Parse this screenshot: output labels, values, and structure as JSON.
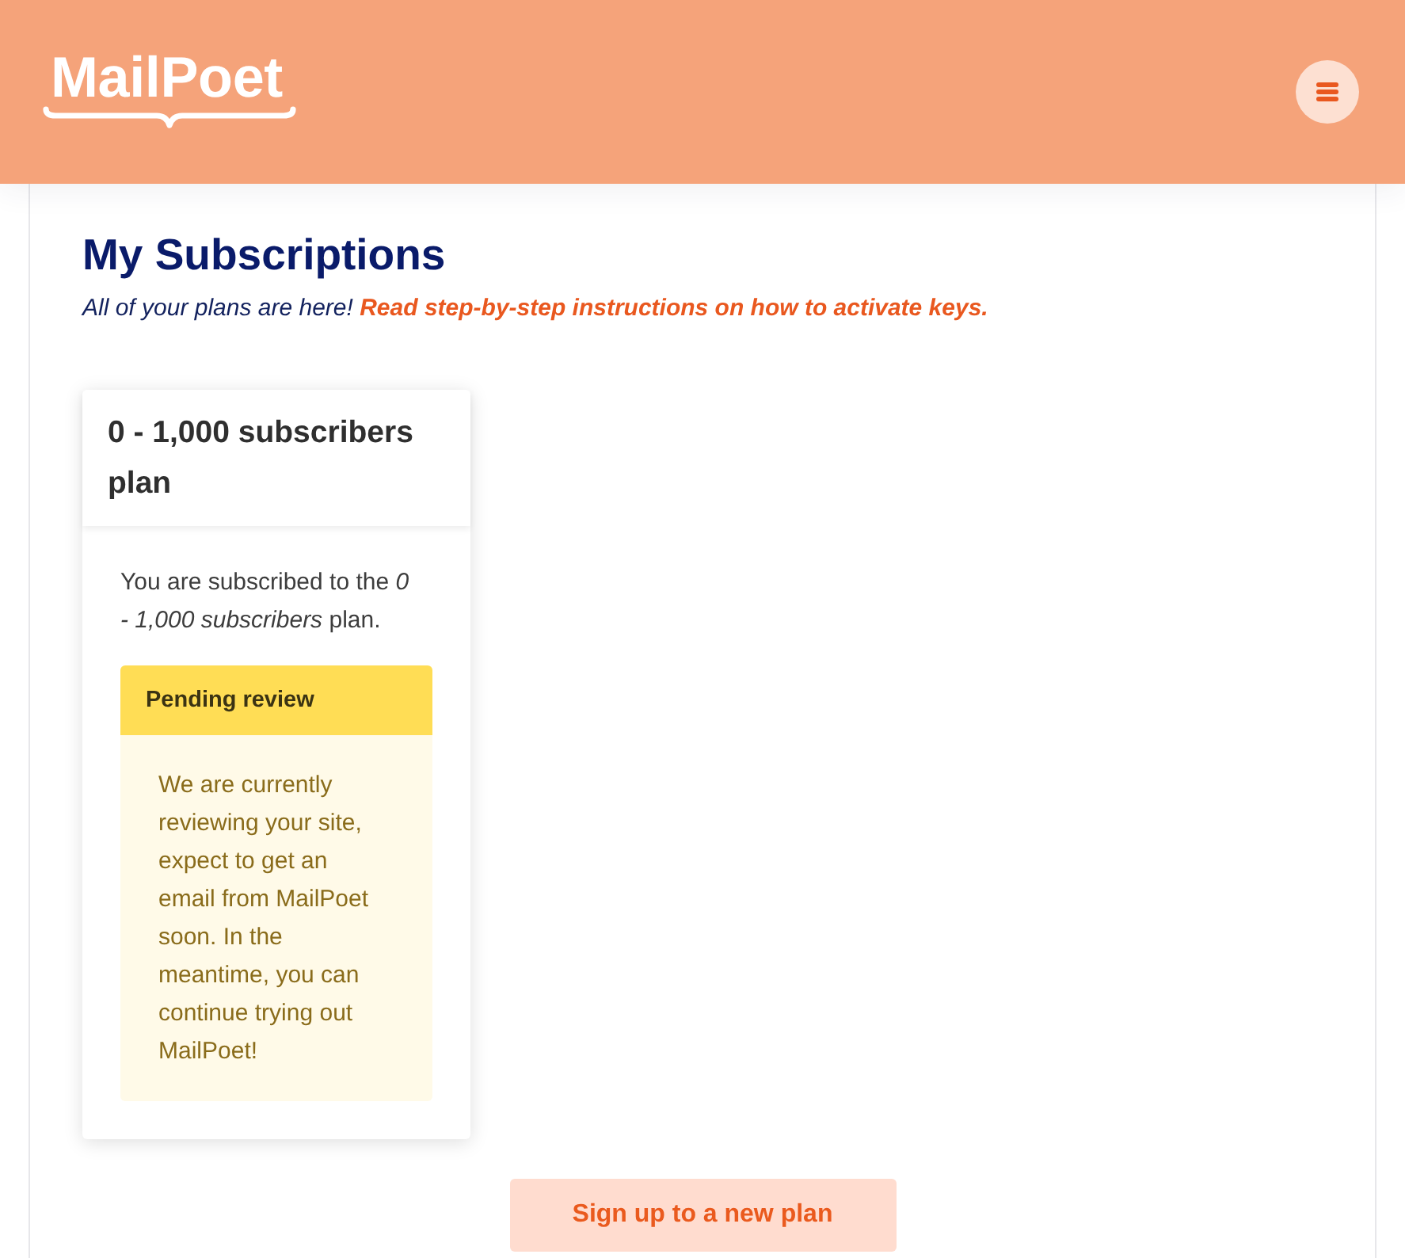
{
  "header": {
    "logo": "MailPoet"
  },
  "page": {
    "title": "My Subscriptions",
    "intro": "All of your plans are here!",
    "intro_link": "Read step-by-step instructions on how to activate keys."
  },
  "plans": [
    {
      "title": "0 - 1,000 subscribers plan",
      "description": "You are subscribed to the *0 - 1,000 subscribers* plan.",
      "notice": {
        "kind": "pending",
        "title": "Pending review",
        "message": "We are currently reviewing your site, expect to get an email from MailPoet soon. In the meantime, you can continue trying out MailPoet!"
      }
    }
  ],
  "signup_button": "Sign up to a new plan"
}
